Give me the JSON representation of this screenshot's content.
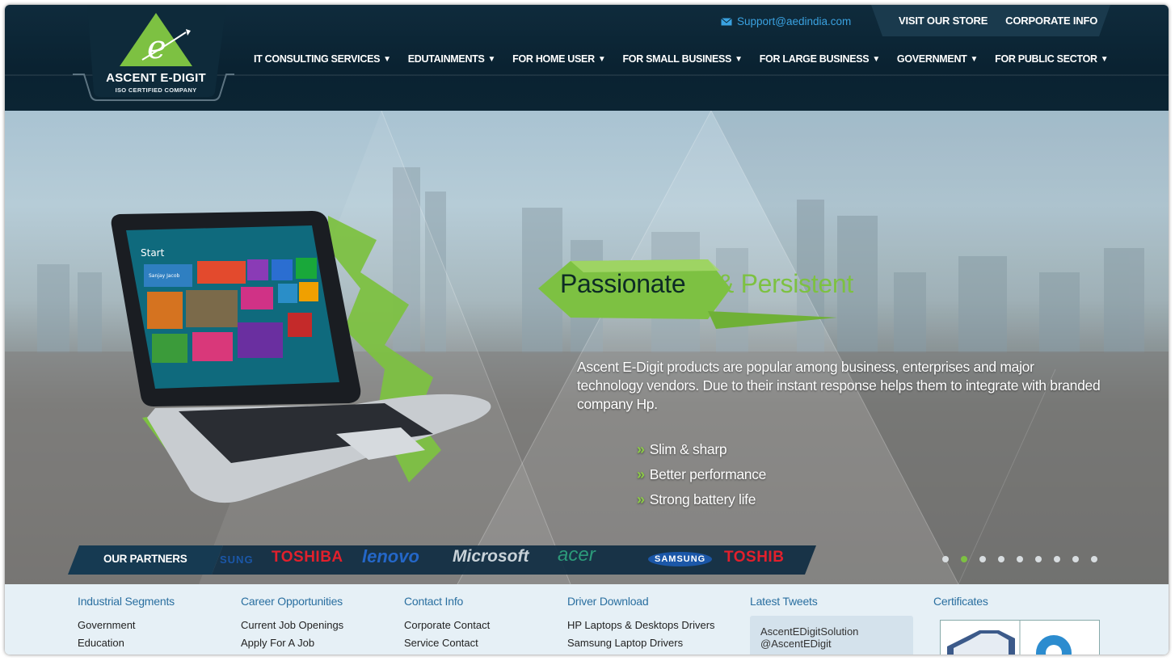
{
  "brand": {
    "name": "ASCENT E-DIGIT",
    "tagline": "ISO CERTIFIED COMPANY",
    "logo_letter": "e"
  },
  "support": {
    "icon": "mail-icon",
    "email": "Support@aedindia.com"
  },
  "topbar": {
    "store": "VISIT OUR STORE",
    "corporate": "CORPORATE INFO"
  },
  "nav": [
    {
      "label": "IT CONSULTING SERVICES"
    },
    {
      "label": "EDUTAINMENTS"
    },
    {
      "label": "FOR HOME USER"
    },
    {
      "label": "FOR SMALL BUSINESS"
    },
    {
      "label": "FOR LARGE BUSINESS"
    },
    {
      "label": "GOVERNMENT"
    },
    {
      "label": "FOR PUBLIC SECTOR"
    }
  ],
  "nav_caret": "▼",
  "hero": {
    "headline_1": "Passionate",
    "headline_2": "& Persistent",
    "description": "Ascent E-Digit products are popular among business, enterprises and major technology vendors. Due to their instant response helps them to integrate with branded company Hp.",
    "features": [
      "Slim & sharp",
      "Better performance",
      "Strong battery life"
    ],
    "feature_marker": "»",
    "laptop_screen": {
      "start": "Start",
      "user": "Sanjay Jacob"
    },
    "slides_total": 9,
    "active_slide": 2
  },
  "partners": {
    "label": "OUR PARTNERS",
    "logos": [
      "SUNG",
      "TOSHIBA",
      "lenovo",
      "Microsoft",
      "acer",
      "SAMSUNG",
      "TOSHIB"
    ]
  },
  "footer": {
    "industrial": {
      "title": "Industrial Segments",
      "links": [
        "Government",
        "Education"
      ]
    },
    "career": {
      "title": "Career Opportunities",
      "links": [
        "Current Job Openings",
        "Apply For A Job"
      ]
    },
    "contact": {
      "title": "Contact Info",
      "links": [
        "Corporate Contact",
        "Service Contact"
      ]
    },
    "drivers": {
      "title": "Driver Download",
      "links": [
        "HP Laptops & Desktops Drivers",
        "Samsung Laptop Drivers"
      ]
    },
    "tweets": {
      "title": "Latest Tweets",
      "name": "AscentEDigitSolution",
      "handle": "@AscentEDigit"
    },
    "certificates": {
      "title": "Certificates"
    }
  },
  "colors": {
    "header_bg": "#0b2433",
    "accent_green": "#7dc142",
    "link_blue": "#2a6fa0",
    "support_blue": "#3aa2e0"
  }
}
